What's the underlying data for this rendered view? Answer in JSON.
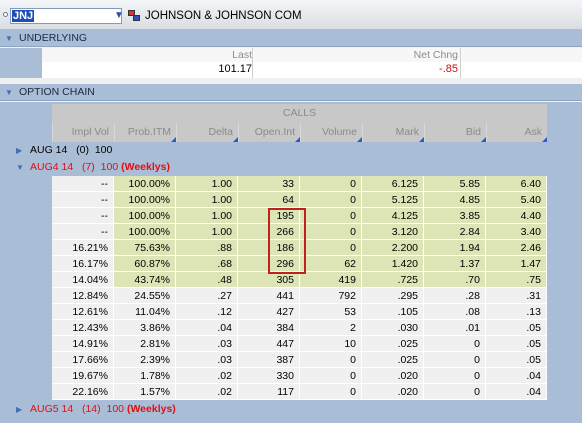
{
  "header": {
    "symbol": "JNJ",
    "company": "JOHNSON & JOHNSON COM"
  },
  "underlying": {
    "section_label": "UNDERLYING",
    "columns": [
      "Last",
      "Net Chng"
    ],
    "last": "101.17",
    "net_chng": "-.85"
  },
  "chain": {
    "section_label": "OPTION CHAIN",
    "group_label": "CALLS",
    "columns": [
      "Impl Vol",
      "Prob.ITM",
      "Delta",
      "Open.Int",
      "Volume",
      "Mark",
      "Bid",
      "Ask"
    ],
    "expirations": [
      {
        "label": "AUG 14",
        "count": "(0)",
        "mult": "100",
        "weeklys": ""
      },
      {
        "label": "AUG4 14",
        "count": "(7)",
        "mult": "100",
        "weeklys": "(Weeklys)"
      },
      {
        "label": "AUG5 14",
        "count": "(14)",
        "mult": "100",
        "weeklys": "(Weeklys)"
      }
    ],
    "rows": [
      {
        "iv": "--",
        "prob": "100.00%",
        "delta": "1.00",
        "oi": "33",
        "vol": "0",
        "mark": "6.125",
        "bid": "5.85",
        "ask": "6.40",
        "itm": true
      },
      {
        "iv": "--",
        "prob": "100.00%",
        "delta": "1.00",
        "oi": "64",
        "vol": "0",
        "mark": "5.125",
        "bid": "4.85",
        "ask": "5.40",
        "itm": true
      },
      {
        "iv": "--",
        "prob": "100.00%",
        "delta": "1.00",
        "oi": "195",
        "vol": "0",
        "mark": "4.125",
        "bid": "3.85",
        "ask": "4.40",
        "itm": true
      },
      {
        "iv": "--",
        "prob": "100.00%",
        "delta": "1.00",
        "oi": "266",
        "vol": "0",
        "mark": "3.120",
        "bid": "2.84",
        "ask": "3.40",
        "itm": true
      },
      {
        "iv": "16.21%",
        "prob": "75.63%",
        "delta": ".88",
        "oi": "186",
        "vol": "0",
        "mark": "2.200",
        "bid": "1.94",
        "ask": "2.46",
        "itm": true
      },
      {
        "iv": "16.17%",
        "prob": "60.87%",
        "delta": ".68",
        "oi": "296",
        "vol": "62",
        "mark": "1.420",
        "bid": "1.37",
        "ask": "1.47",
        "itm": true
      },
      {
        "iv": "14.04%",
        "prob": "43.74%",
        "delta": ".48",
        "oi": "305",
        "vol": "419",
        "mark": ".725",
        "bid": ".70",
        "ask": ".75",
        "itm": true
      },
      {
        "iv": "12.84%",
        "prob": "24.55%",
        "delta": ".27",
        "oi": "441",
        "vol": "792",
        "mark": ".295",
        "bid": ".28",
        "ask": ".31",
        "itm": false
      },
      {
        "iv": "12.61%",
        "prob": "11.04%",
        "delta": ".12",
        "oi": "427",
        "vol": "53",
        "mark": ".105",
        "bid": ".08",
        "ask": ".13",
        "itm": false
      },
      {
        "iv": "12.43%",
        "prob": "3.86%",
        "delta": ".04",
        "oi": "384",
        "vol": "2",
        "mark": ".030",
        "bid": ".01",
        "ask": ".05",
        "itm": false
      },
      {
        "iv": "14.91%",
        "prob": "2.81%",
        "delta": ".03",
        "oi": "447",
        "vol": "10",
        "mark": ".025",
        "bid": "0",
        "ask": ".05",
        "itm": false
      },
      {
        "iv": "17.66%",
        "prob": "2.39%",
        "delta": ".03",
        "oi": "387",
        "vol": "0",
        "mark": ".025",
        "bid": "0",
        "ask": ".05",
        "itm": false
      },
      {
        "iv": "19.67%",
        "prob": "1.78%",
        "delta": ".02",
        "oi": "330",
        "vol": "0",
        "mark": ".020",
        "bid": "0",
        "ask": ".04",
        "itm": false
      },
      {
        "iv": "22.16%",
        "prob": "1.57%",
        "delta": ".02",
        "oi": "117",
        "vol": "0",
        "mark": ".020",
        "bid": "0",
        "ask": ".04",
        "itm": false
      }
    ]
  },
  "colors": {
    "itm_row": "#dde5b6",
    "otm_row": "#f0f0f0",
    "section_bg": "#a9bdd6",
    "negative": "#d01010",
    "weeklys": "#e01010",
    "highlight_box": "#c02020"
  }
}
